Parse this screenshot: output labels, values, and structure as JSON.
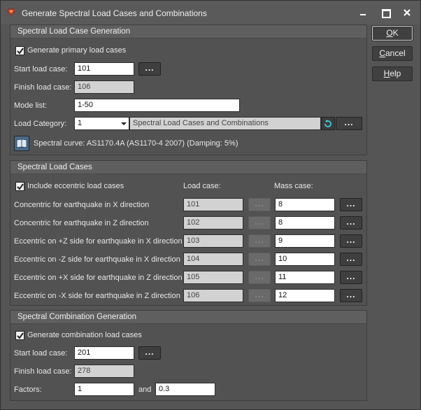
{
  "window": {
    "title": "Generate Spectral Load Cases and Combinations"
  },
  "dialog_buttons": {
    "ok": {
      "first": "O",
      "rest": "K"
    },
    "cancel": {
      "first": "C",
      "rest": "ancel"
    },
    "help": {
      "first": "H",
      "rest": "elp"
    }
  },
  "generation": {
    "header": "Spectral Load Case Generation",
    "generate_primary_label": "Generate primary load cases",
    "generate_primary_checked": true,
    "start_label": "Start load case:",
    "start_value": "101",
    "finish_label": "Finish load case:",
    "finish_value": "106",
    "mode_label": "Mode list:",
    "mode_value": "1-50",
    "category_label": "Load Category:",
    "category_number": "1",
    "category_name": "Spectral Load Cases and Combinations",
    "spectral_curve": "Spectral curve: AS1170.4A (AS1170-4 2007) (Damping: 5%)"
  },
  "cases": {
    "header": "Spectral Load Cases",
    "include_eccentric_label": "Include eccentric load cases",
    "include_eccentric_checked": true,
    "col_load_case": "Load case:",
    "col_mass_case": "Mass case:",
    "rows": [
      {
        "label": "Concentric for earthquake in X direction",
        "load_case": "101",
        "mass_case": "8"
      },
      {
        "label": "Concentric for earthquake in Z direction",
        "load_case": "102",
        "mass_case": "8"
      },
      {
        "label": "Eccentric on +Z side for earthquake in X direction",
        "load_case": "103",
        "mass_case": "9"
      },
      {
        "label": "Eccentric on -Z side for earthquake in X direction",
        "load_case": "104",
        "mass_case": "10"
      },
      {
        "label": "Eccentric on +X side for earthquake in Z direction",
        "load_case": "105",
        "mass_case": "11"
      },
      {
        "label": "Eccentric on -X side for earthquake in Z direction",
        "load_case": "106",
        "mass_case": "12"
      }
    ]
  },
  "combination": {
    "header": "Spectral Combination Generation",
    "generate_combination_label": "Generate combination load cases",
    "generate_combination_checked": true,
    "start_label": "Start load case:",
    "start_value": "201",
    "finish_label": "Finish load case:",
    "finish_value": "278",
    "factors_label": "Factors:",
    "factor1": "1",
    "and_label": "and",
    "factor2": "0.3"
  },
  "ellipsis": "...",
  "colors": {
    "window_bg": "#555555",
    "accent_refresh": "#3fd0e0"
  }
}
